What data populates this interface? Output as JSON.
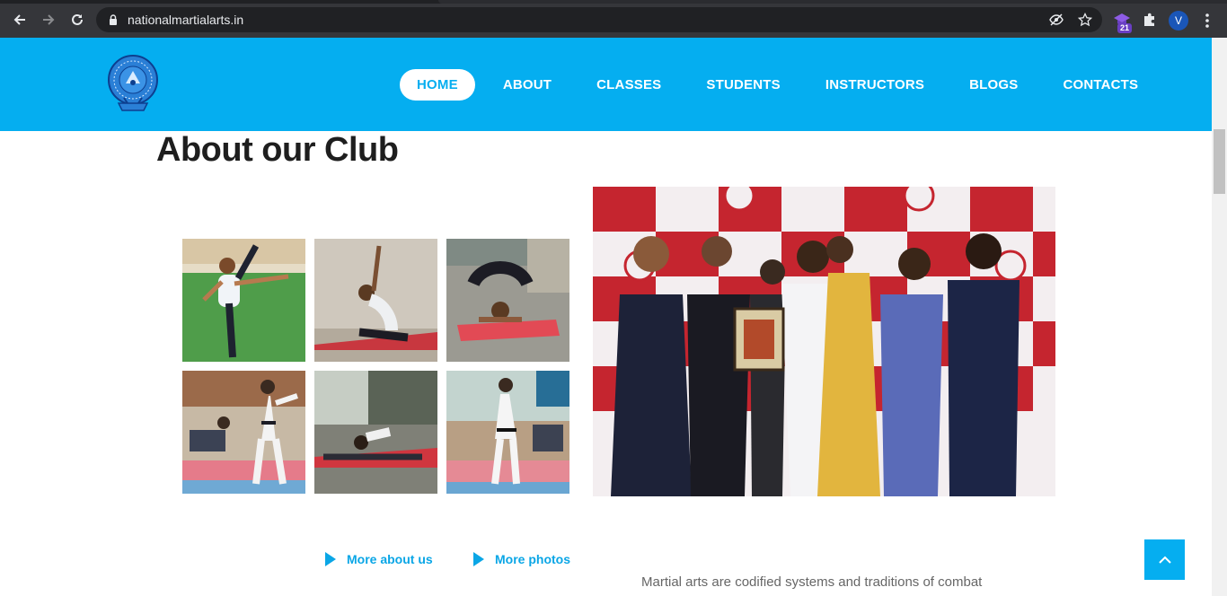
{
  "browser": {
    "url": "nationalmartialarts.in",
    "extension_badge": "21",
    "profile_initial": "V"
  },
  "site": {
    "brand_color": "#05aef0",
    "nav": [
      {
        "label": "HOME",
        "active": true
      },
      {
        "label": "ABOUT",
        "active": false
      },
      {
        "label": "CLASSES",
        "active": false
      },
      {
        "label": "STUDENTS",
        "active": false
      },
      {
        "label": "INSTRUCTORS",
        "active": false
      },
      {
        "label": "BLOGS",
        "active": false
      },
      {
        "label": "CONTACTS",
        "active": false
      }
    ]
  },
  "about": {
    "title": "About our Club",
    "links": [
      {
        "label": "More about us",
        "icon": "play-icon"
      },
      {
        "label": "More photos",
        "icon": "play-icon"
      }
    ],
    "intro_text": "Martial arts are codified systems and traditions of combat"
  }
}
